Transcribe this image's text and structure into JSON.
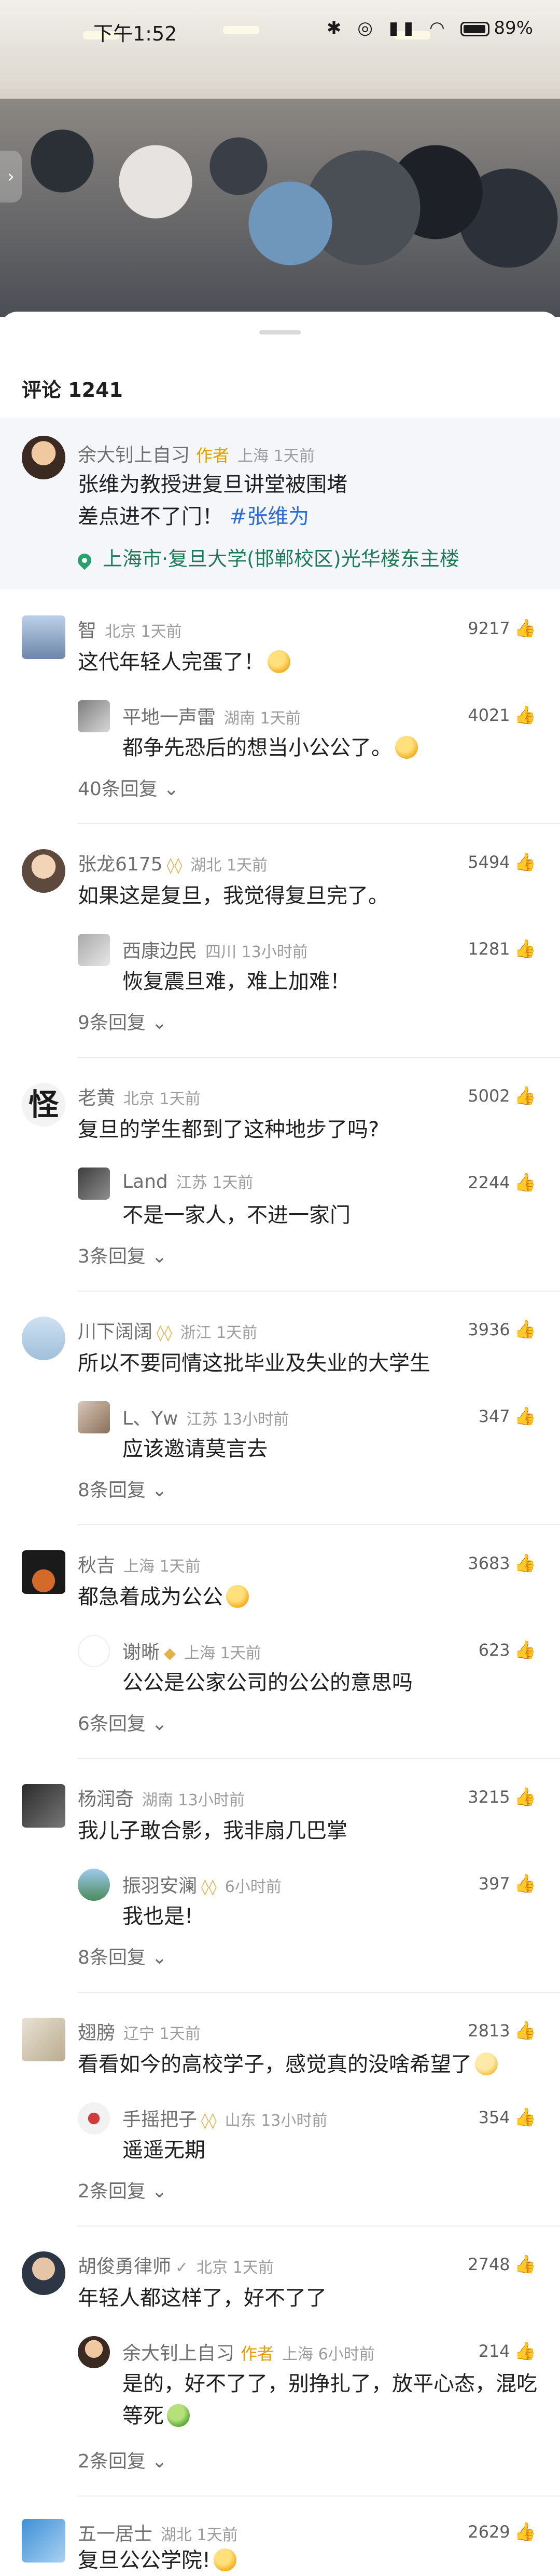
{
  "status_bar": {
    "time": "下午1:52",
    "battery": "89"
  },
  "panel": {
    "title": "评论 1241"
  },
  "pinned": {
    "name": "余大钊上自习",
    "author_tag": "作者",
    "meta": "上海 1天前",
    "line1": "张维为教授进复旦讲堂被围堵",
    "line2": "差点进不了门！",
    "hashtag": "#张维为",
    "location": "上海市·复旦大学(邯郸校区)光华楼东主楼"
  },
  "comments": [
    {
      "name": "智",
      "meta": "北京 1天前",
      "text": "这代年轻人完蛋了！",
      "likes": "9217",
      "reply": {
        "name": "平地一声雷",
        "meta": "湖南 1天前",
        "text": "都争先恐后的想当小公公了。",
        "likes": "4021"
      },
      "more": "40条回复"
    },
    {
      "name": "张龙6175",
      "meta": "湖北 1天前",
      "text": "如果这是复旦，我觉得复旦完了。",
      "likes": "5494",
      "reply": {
        "name": "西康边民",
        "meta": "四川 13小时前",
        "text": "恢复震旦难，难上加难！",
        "likes": "1281"
      },
      "more": "9条回复"
    },
    {
      "name": "老黄",
      "meta": "北京 1天前",
      "text": "复旦的学生都到了这种地步了吗?",
      "likes": "5002",
      "reply": {
        "name": "Land",
        "meta": "江苏 1天前",
        "text": "不是一家人，不进一家门",
        "likes": "2244"
      },
      "more": "3条回复"
    },
    {
      "name": "川下阔阔",
      "meta": "浙江 1天前",
      "text": "所以不要同情这批毕业及失业的大学生",
      "likes": "3936",
      "reply": {
        "name": "L、Yw",
        "meta": "江苏 13小时前",
        "text": "应该邀请莫言去",
        "likes": "347"
      },
      "more": "8条回复"
    },
    {
      "name": "秋吉",
      "meta": "上海 1天前",
      "text": "都急着成为公公",
      "likes": "3683",
      "reply": {
        "name": "谢晰",
        "meta": "上海 1天前",
        "text": "公公是公家公司的公公的意思吗",
        "likes": "623"
      },
      "more": "6条回复"
    },
    {
      "name": "杨润奇",
      "meta": "湖南 13小时前",
      "text": "我儿子敢合影，我非扇几巴掌",
      "likes": "3215",
      "reply": {
        "name": "振羽安澜",
        "meta": "6小时前",
        "text": "我也是!",
        "likes": "397"
      },
      "more": "8条回复"
    },
    {
      "name": "翅膀",
      "meta": "辽宁 1天前",
      "text": "看看如今的高校学子，感觉真的没啥希望了",
      "likes": "2813",
      "reply": {
        "name": "手摇把子",
        "meta": "山东 13小时前",
        "text": "遥遥无期",
        "likes": "354"
      },
      "more": "2条回复"
    },
    {
      "name": "胡俊勇律师",
      "meta": "北京 1天前",
      "text": "年轻人都这样了，好不了了",
      "likes": "2748",
      "reply": {
        "name": "余大钊上自习",
        "tag": "作者",
        "meta": "上海 6小时前",
        "text1": "是的，好不了了，别挣扎了，放平心态，混吃",
        "text2": "等死",
        "likes": "214"
      },
      "more": "2条回复"
    },
    {
      "name": "五一居士",
      "meta": "湖北 1天前",
      "text": "复旦公公学院!",
      "likes": "2629"
    }
  ]
}
